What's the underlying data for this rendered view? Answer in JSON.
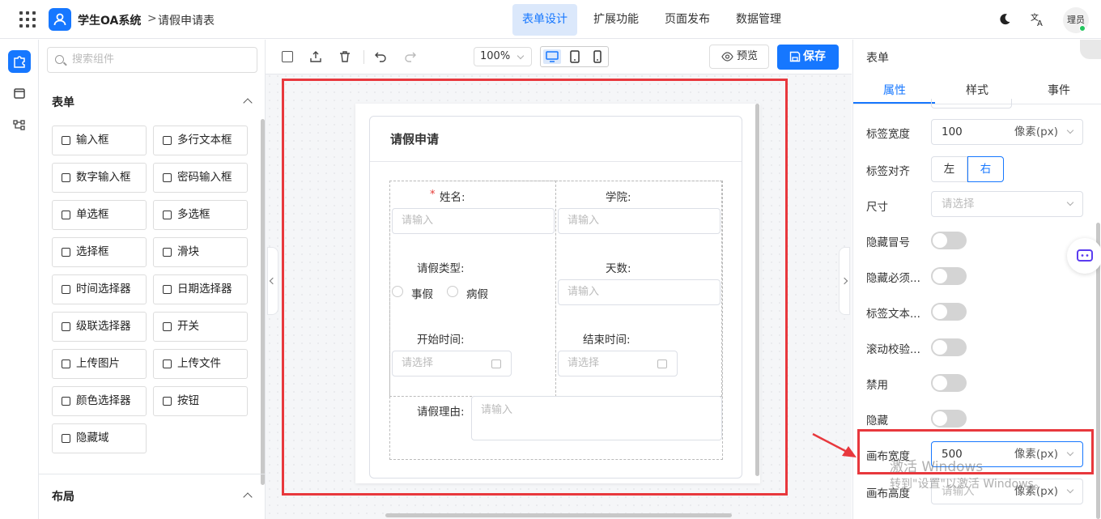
{
  "header": {
    "app_title": "学生OA系统",
    "breadcrumb_sep": ">",
    "breadcrumb": "请假申请表",
    "tabs": [
      {
        "label": "表单设计",
        "active": true
      },
      {
        "label": "扩展功能"
      },
      {
        "label": "页面发布"
      },
      {
        "label": "数据管理"
      }
    ],
    "avatar_text": "理员",
    "accent": "#1677ff"
  },
  "left_panel": {
    "search_placeholder": "搜索组件",
    "form_section": "表单",
    "components": [
      {
        "label": "输入框",
        "icon": "pencil-icon"
      },
      {
        "label": "多行文本框",
        "icon": "textarea-icon"
      },
      {
        "label": "数字输入框",
        "icon": "number-icon"
      },
      {
        "label": "密码输入框",
        "icon": "lock-icon"
      },
      {
        "label": "单选框",
        "icon": "radio-icon"
      },
      {
        "label": "多选框",
        "icon": "checkbox-icon"
      },
      {
        "label": "选择框",
        "icon": "select-icon"
      },
      {
        "label": "滑块",
        "icon": "slider-icon"
      },
      {
        "label": "时间选择器",
        "icon": "clock-icon"
      },
      {
        "label": "日期选择器",
        "icon": "calendar-icon"
      },
      {
        "label": "级联选择器",
        "icon": "cascader-icon"
      },
      {
        "label": "开关",
        "icon": "switch-icon"
      },
      {
        "label": "上传图片",
        "icon": "image-icon"
      },
      {
        "label": "上传文件",
        "icon": "upload-icon"
      },
      {
        "label": "颜色选择器",
        "icon": "palette-icon"
      },
      {
        "label": "按钮",
        "icon": "button-icon"
      },
      {
        "label": "隐藏域",
        "icon": "eye-off-icon"
      }
    ],
    "layout_section": "布局"
  },
  "toolbar": {
    "zoom": "100%",
    "preview_label": "预览",
    "save_label": "保存"
  },
  "form": {
    "title": "请假申请",
    "required_mark": "*",
    "name_label": "姓名:",
    "name_placeholder": "请输入",
    "college_label": "学院:",
    "college_placeholder": "请输入",
    "leave_type_label": "请假类型:",
    "leave_options": [
      "事假",
      "病假"
    ],
    "days_label": "天数:",
    "days_placeholder": "请输入",
    "start_label": "开始时间:",
    "start_placeholder": "请选择",
    "end_label": "结束时间:",
    "end_placeholder": "请选择",
    "reason_label": "请假理由:",
    "reason_placeholder": "请输入"
  },
  "right_panel": {
    "title": "表单",
    "tabs": [
      "属性",
      "样式",
      "事件"
    ],
    "label_width_label": "标签宽度",
    "label_width_value": "100",
    "unit": "像素(px)",
    "label_align_label": "标签对齐",
    "align_left": "左",
    "align_right": "右",
    "size_label": "尺寸",
    "size_placeholder": "请选择",
    "hide_colon_label": "隐藏冒号",
    "hide_required_label": "隐藏必须...",
    "label_text_label": "标签文本...",
    "scroll_validate_label": "滚动校验...",
    "disabled_label": "禁用",
    "hidden_label": "隐藏",
    "canvas_width_label": "画布宽度",
    "canvas_width_value": "500",
    "canvas_height_label": "画布高度",
    "canvas_height_placeholder": "请输入"
  },
  "watermark": {
    "line1": "激活 Windows",
    "line2": "转到\"设置\"以激活 Windows。"
  }
}
